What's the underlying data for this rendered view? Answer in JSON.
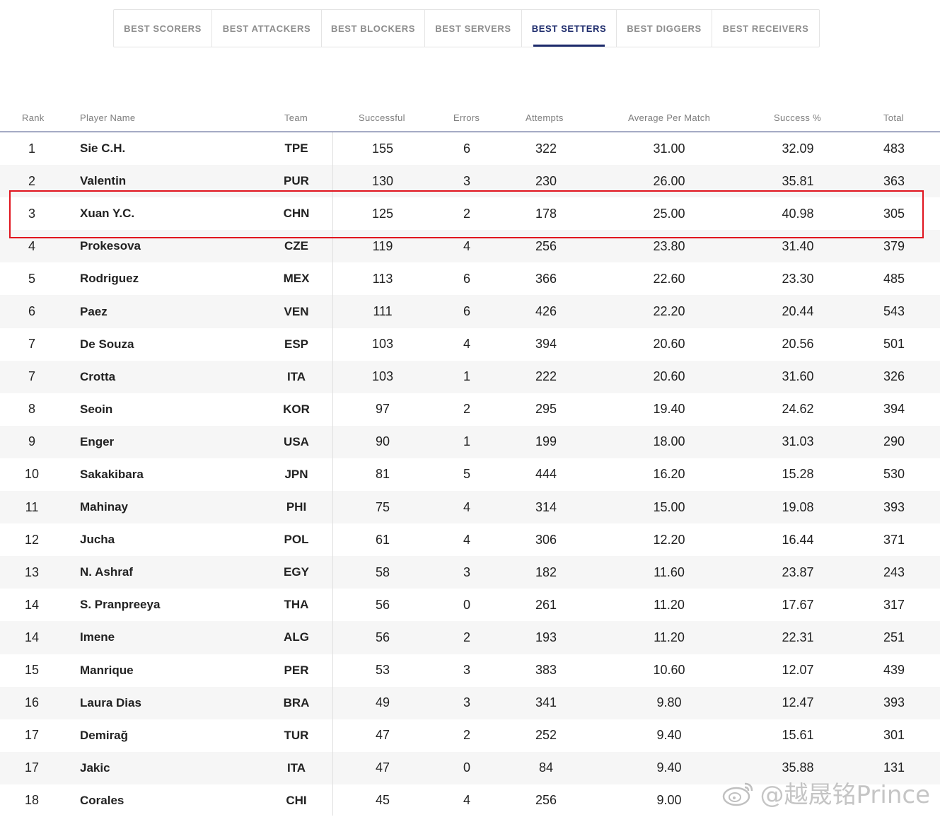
{
  "tabs": [
    {
      "label": "BEST SCORERS",
      "active": false
    },
    {
      "label": "BEST ATTACKERS",
      "active": false
    },
    {
      "label": "BEST BLOCKERS",
      "active": false
    },
    {
      "label": "BEST SERVERS",
      "active": false
    },
    {
      "label": "BEST SETTERS",
      "active": true
    },
    {
      "label": "BEST DIGGERS",
      "active": false
    },
    {
      "label": "BEST RECEIVERS",
      "active": false
    }
  ],
  "columns": {
    "rank": "Rank",
    "player": "Player Name",
    "team": "Team",
    "successful": "Successful",
    "errors": "Errors",
    "attempts": "Attempts",
    "avg": "Average Per Match",
    "success_pct": "Success %",
    "total": "Total"
  },
  "rows": [
    {
      "rank": "1",
      "player": "Sie C.H.",
      "team": "TPE",
      "successful": "155",
      "errors": "6",
      "attempts": "322",
      "avg": "31.00",
      "success_pct": "32.09",
      "total": "483"
    },
    {
      "rank": "2",
      "player": "Valentin",
      "team": "PUR",
      "successful": "130",
      "errors": "3",
      "attempts": "230",
      "avg": "26.00",
      "success_pct": "35.81",
      "total": "363"
    },
    {
      "rank": "3",
      "player": "Xuan Y.C.",
      "team": "CHN",
      "successful": "125",
      "errors": "2",
      "attempts": "178",
      "avg": "25.00",
      "success_pct": "40.98",
      "total": "305"
    },
    {
      "rank": "4",
      "player": "Prokesova",
      "team": "CZE",
      "successful": "119",
      "errors": "4",
      "attempts": "256",
      "avg": "23.80",
      "success_pct": "31.40",
      "total": "379"
    },
    {
      "rank": "5",
      "player": "Rodriguez",
      "team": "MEX",
      "successful": "113",
      "errors": "6",
      "attempts": "366",
      "avg": "22.60",
      "success_pct": "23.30",
      "total": "485"
    },
    {
      "rank": "6",
      "player": "Paez",
      "team": "VEN",
      "successful": "111",
      "errors": "6",
      "attempts": "426",
      "avg": "22.20",
      "success_pct": "20.44",
      "total": "543"
    },
    {
      "rank": "7",
      "player": "De Souza",
      "team": "ESP",
      "successful": "103",
      "errors": "4",
      "attempts": "394",
      "avg": "20.60",
      "success_pct": "20.56",
      "total": "501"
    },
    {
      "rank": "7",
      "player": "Crotta",
      "team": "ITA",
      "successful": "103",
      "errors": "1",
      "attempts": "222",
      "avg": "20.60",
      "success_pct": "31.60",
      "total": "326"
    },
    {
      "rank": "8",
      "player": "Seoin",
      "team": "KOR",
      "successful": "97",
      "errors": "2",
      "attempts": "295",
      "avg": "19.40",
      "success_pct": "24.62",
      "total": "394"
    },
    {
      "rank": "9",
      "player": "Enger",
      "team": "USA",
      "successful": "90",
      "errors": "1",
      "attempts": "199",
      "avg": "18.00",
      "success_pct": "31.03",
      "total": "290"
    },
    {
      "rank": "10",
      "player": "Sakakibara",
      "team": "JPN",
      "successful": "81",
      "errors": "5",
      "attempts": "444",
      "avg": "16.20",
      "success_pct": "15.28",
      "total": "530"
    },
    {
      "rank": "11",
      "player": "Mahinay",
      "team": "PHI",
      "successful": "75",
      "errors": "4",
      "attempts": "314",
      "avg": "15.00",
      "success_pct": "19.08",
      "total": "393"
    },
    {
      "rank": "12",
      "player": "Jucha",
      "team": "POL",
      "successful": "61",
      "errors": "4",
      "attempts": "306",
      "avg": "12.20",
      "success_pct": "16.44",
      "total": "371"
    },
    {
      "rank": "13",
      "player": "N. Ashraf",
      "team": "EGY",
      "successful": "58",
      "errors": "3",
      "attempts": "182",
      "avg": "11.60",
      "success_pct": "23.87",
      "total": "243"
    },
    {
      "rank": "14",
      "player": "S. Pranpreeya",
      "team": "THA",
      "successful": "56",
      "errors": "0",
      "attempts": "261",
      "avg": "11.20",
      "success_pct": "17.67",
      "total": "317"
    },
    {
      "rank": "14",
      "player": "Imene",
      "team": "ALG",
      "successful": "56",
      "errors": "2",
      "attempts": "193",
      "avg": "11.20",
      "success_pct": "22.31",
      "total": "251"
    },
    {
      "rank": "15",
      "player": "Manrique",
      "team": "PER",
      "successful": "53",
      "errors": "3",
      "attempts": "383",
      "avg": "10.60",
      "success_pct": "12.07",
      "total": "439"
    },
    {
      "rank": "16",
      "player": "Laura Dias",
      "team": "BRA",
      "successful": "49",
      "errors": "3",
      "attempts": "341",
      "avg": "9.80",
      "success_pct": "12.47",
      "total": "393"
    },
    {
      "rank": "17",
      "player": "Demirağ",
      "team": "TUR",
      "successful": "47",
      "errors": "2",
      "attempts": "252",
      "avg": "9.40",
      "success_pct": "15.61",
      "total": "301"
    },
    {
      "rank": "17",
      "player": "Jakic",
      "team": "ITA",
      "successful": "47",
      "errors": "0",
      "attempts": "84",
      "avg": "9.40",
      "success_pct": "35.88",
      "total": "131"
    },
    {
      "rank": "18",
      "player": "Corales",
      "team": "CHI",
      "successful": "45",
      "errors": "4",
      "attempts": "256",
      "avg": "9.00",
      "success_pct": "",
      "total": ""
    }
  ],
  "highlight_row": 3,
  "watermark": {
    "text": "@越晟铭Prince",
    "icon": "weibo-icon"
  },
  "colors": {
    "accent": "#1c2a6b",
    "highlight": "#e0141e",
    "alt_row": "#f6f6f6"
  }
}
